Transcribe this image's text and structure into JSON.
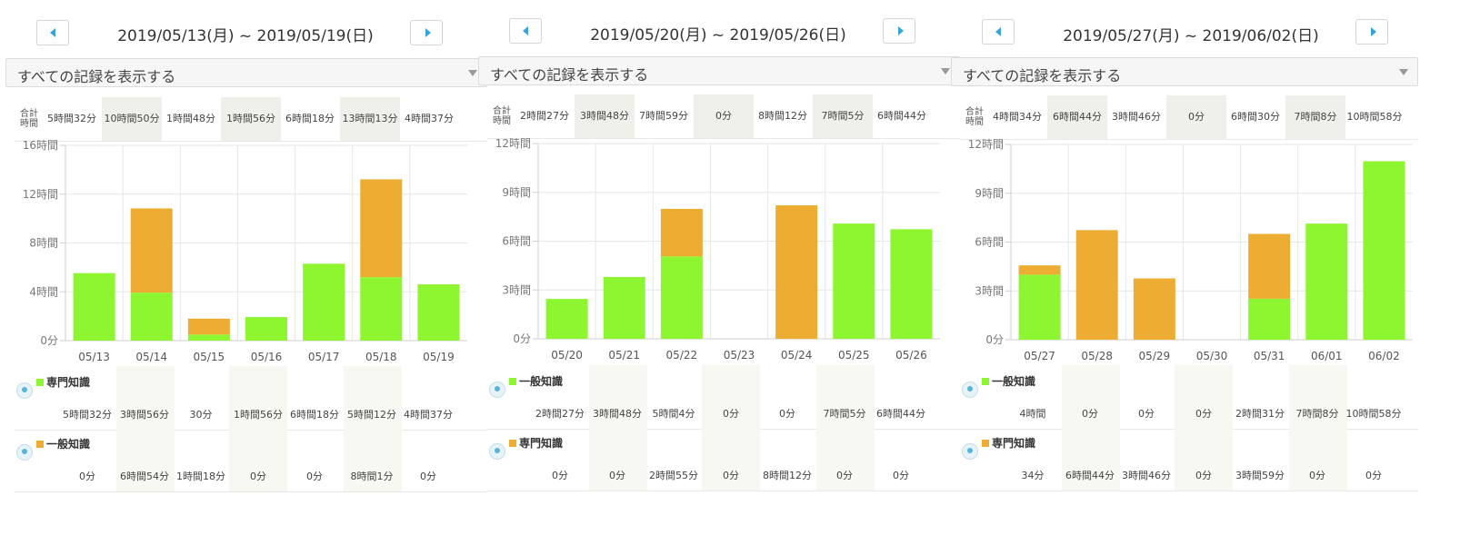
{
  "colors": {
    "green": "#8ef531",
    "orange": "#edac32",
    "grid": "#e6e6e6",
    "axis": "#cfcfcf"
  },
  "totals_label": [
    "合計",
    "時間"
  ],
  "panels": [
    {
      "nav_prev": "prev-week",
      "nav_next": "next-week",
      "range_title": "2019/05/13(月) ~ 2019/05/19(日)",
      "filter_label": "すべての記録を表示する",
      "totals": [
        "5時間32分",
        "10時間50分",
        "1時間48分",
        "1時間56分",
        "6時間18分",
        "13時間13分",
        "4時間37分"
      ],
      "legend": [
        {
          "name": "専門知識",
          "color": "green",
          "values": [
            "5時間32分",
            "3時間56分",
            "30分",
            "1時間56分",
            "6時間18分",
            "5時間12分",
            "4時間37分"
          ]
        },
        {
          "name": "一般知識",
          "color": "orange",
          "values": [
            "0分",
            "6時間54分",
            "1時間18分",
            "0分",
            "0分",
            "8時間1分",
            "0分"
          ]
        }
      ]
    },
    {
      "range_title": "2019/05/20(月) ~ 2019/05/26(日)",
      "filter_label": "すべての記録を表示する",
      "totals": [
        "2時間27分",
        "3時間48分",
        "7時間59分",
        "0分",
        "8時間12分",
        "7時間5分",
        "6時間44分"
      ],
      "legend": [
        {
          "name": "一般知識",
          "color": "green",
          "values": [
            "2時間27分",
            "3時間48分",
            "5時間4分",
            "0分",
            "0分",
            "7時間5分",
            "6時間44分"
          ]
        },
        {
          "name": "専門知識",
          "color": "orange",
          "values": [
            "0分",
            "0分",
            "2時間55分",
            "0分",
            "8時間12分",
            "0分",
            "0分"
          ]
        }
      ]
    },
    {
      "range_title": "2019/05/27(月) ~ 2019/06/02(日)",
      "filter_label": "すべての記録を表示する",
      "totals": [
        "4時間34分",
        "6時間44分",
        "3時間46分",
        "0分",
        "6時間30分",
        "7時間8分",
        "10時間58分"
      ],
      "legend": [
        {
          "name": "一般知識",
          "color": "green",
          "values": [
            "4時間",
            "0分",
            "0分",
            "0分",
            "2時間31分",
            "7時間8分",
            "10時間58分"
          ]
        },
        {
          "name": "専門知識",
          "color": "orange",
          "values": [
            "34分",
            "6時間44分",
            "3時間46分",
            "0分",
            "3時間59分",
            "0分",
            "0分"
          ]
        }
      ]
    }
  ],
  "chart_data": [
    {
      "type": "bar",
      "stacked": true,
      "categories": [
        "05/13",
        "05/14",
        "05/15",
        "05/16",
        "05/17",
        "05/18",
        "05/19"
      ],
      "series": [
        {
          "name": "専門知識",
          "color": "#8ef531",
          "values": [
            5.533,
            3.933,
            0.5,
            1.933,
            6.3,
            5.2,
            4.617
          ]
        },
        {
          "name": "一般知識",
          "color": "#edac32",
          "values": [
            0,
            6.9,
            1.3,
            0,
            0,
            8.017,
            0
          ]
        }
      ],
      "ylim": [
        0,
        16
      ],
      "yticks": [
        0,
        4,
        8,
        12,
        16
      ],
      "ytick_labels": [
        "0分",
        "4時間",
        "8時間",
        "12時間",
        "16時間"
      ],
      "grid": true
    },
    {
      "type": "bar",
      "stacked": true,
      "categories": [
        "05/20",
        "05/21",
        "05/22",
        "05/23",
        "05/24",
        "05/25",
        "05/26"
      ],
      "series": [
        {
          "name": "一般知識",
          "color": "#8ef531",
          "values": [
            2.45,
            3.8,
            5.067,
            0,
            0,
            7.083,
            6.733
          ]
        },
        {
          "name": "専門知識",
          "color": "#edac32",
          "values": [
            0,
            0,
            2.917,
            0,
            8.2,
            0,
            0
          ]
        }
      ],
      "ylim": [
        0,
        12
      ],
      "yticks": [
        0,
        3,
        6,
        9,
        12
      ],
      "ytick_labels": [
        "0分",
        "3時間",
        "6時間",
        "9時間",
        "12時間"
      ],
      "grid": true
    },
    {
      "type": "bar",
      "stacked": true,
      "categories": [
        "05/27",
        "05/28",
        "05/29",
        "05/30",
        "05/31",
        "06/01",
        "06/02"
      ],
      "series": [
        {
          "name": "一般知識",
          "color": "#8ef531",
          "values": [
            4.0,
            0,
            0,
            0,
            2.517,
            7.133,
            10.967
          ]
        },
        {
          "name": "専門知識",
          "color": "#edac32",
          "values": [
            0.567,
            6.733,
            3.767,
            0,
            3.983,
            0,
            0
          ]
        }
      ],
      "ylim": [
        0,
        12
      ],
      "yticks": [
        0,
        3,
        6,
        9,
        12
      ],
      "ytick_labels": [
        "0分",
        "3時間",
        "6時間",
        "9時間",
        "12時間"
      ],
      "grid": true
    }
  ]
}
